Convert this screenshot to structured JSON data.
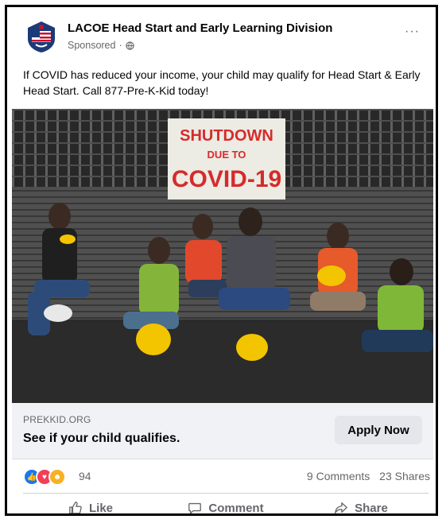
{
  "post": {
    "page_name": "LACOE Head Start and Early Learning Division",
    "sponsored": "Sponsored",
    "separator": "·",
    "more": "···",
    "text": "If COVID has reduced your income, your child may qualify for Head Start & Early Head Start. Call 877-Pre-K-Kid today!"
  },
  "image": {
    "sign_line1": "SHUTDOWN",
    "sign_line2": "DUE TO",
    "sign_line3": "COVID-19"
  },
  "link": {
    "domain": "PREKKID.ORG",
    "headline": "See if your child qualifies.",
    "cta": "Apply Now"
  },
  "engagement": {
    "reaction_count": "94",
    "comments": "9 Comments",
    "shares": "23 Shares"
  },
  "actions": {
    "like": "Like",
    "comment": "Comment",
    "share": "Share"
  },
  "colors": {
    "like_blue": "#1877f2",
    "love_red": "#f33e58",
    "haha_yellow": "#f7b125",
    "sign_red": "#d62b2b"
  }
}
